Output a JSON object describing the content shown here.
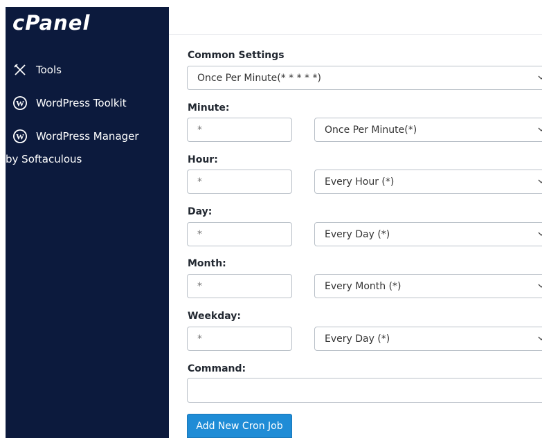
{
  "sidebar": {
    "logo": "cPanel",
    "items": [
      {
        "label": "Tools",
        "icon": "tools-icon"
      },
      {
        "label": "WordPress Toolkit",
        "icon": "wordpress-icon"
      },
      {
        "label": "WordPress Manager",
        "icon": "wordpress-icon",
        "sublabel": "by Softaculous"
      }
    ],
    "background": "#0c1a3d"
  },
  "form": {
    "common_settings": {
      "label": "Common Settings",
      "value": "Once Per Minute(* * * * *)"
    },
    "minute": {
      "label": "Minute:",
      "input": "*",
      "select": "Once Per Minute(*)"
    },
    "hour": {
      "label": "Hour:",
      "input": "*",
      "select": "Every Hour (*)"
    },
    "day": {
      "label": "Day:",
      "input": "*",
      "select": "Every Day (*)"
    },
    "month": {
      "label": "Month:",
      "input": "*",
      "select": "Every Month (*)"
    },
    "weekday": {
      "label": "Weekday:",
      "input": "*",
      "select": "Every Day (*)"
    },
    "command": {
      "label": "Command:",
      "value": ""
    },
    "submit_label": "Add New Cron Job"
  },
  "colors": {
    "accent": "#1f8cd6",
    "sidebar": "#0c1a3d"
  }
}
